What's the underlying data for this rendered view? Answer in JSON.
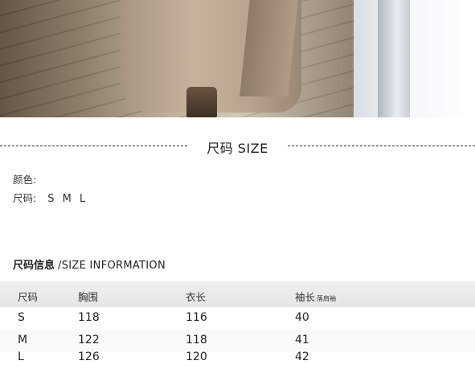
{
  "section_title": "尺码 SIZE",
  "attributes": {
    "color_label": "颜色:",
    "color_value": "",
    "size_label": "尺码:",
    "size_value": "S M L"
  },
  "info_heading": {
    "zh": "尺码信息",
    "en": "/SIZE INFORMATION"
  },
  "table": {
    "headers": [
      "尺码",
      "胸围",
      "衣长",
      "袖长"
    ],
    "sleeve_note": "落肩袖",
    "rows": [
      [
        "S",
        "118",
        "116",
        "40"
      ],
      [
        "M",
        "122",
        "118",
        "41"
      ],
      [
        "L",
        "126",
        "120",
        "42"
      ]
    ]
  }
}
